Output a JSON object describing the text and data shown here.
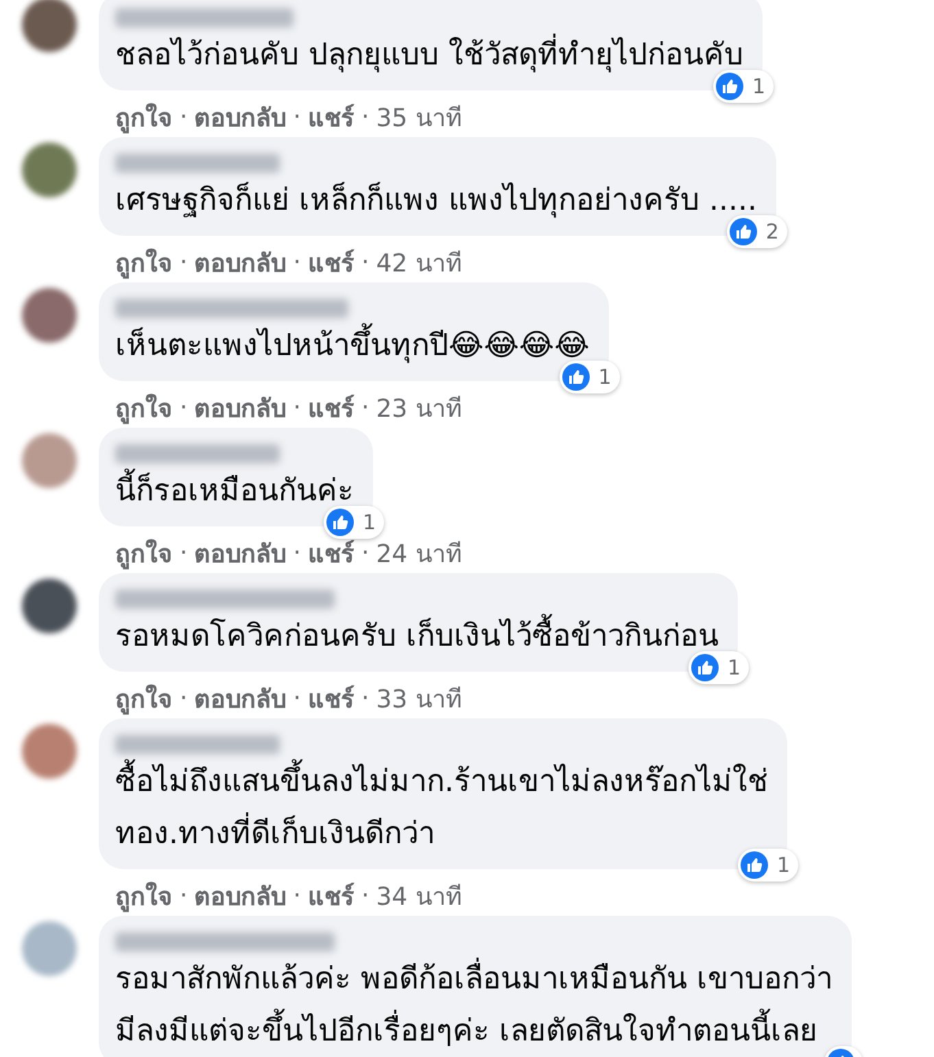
{
  "comments": [
    {
      "text": "ชลอไว้ก่อนคับ ปลุกยุแบบ ใช้วัสดุที่ทำยุไปก่อนคับ",
      "reaction_count": "1",
      "actions": [
        {
          "kind": "link",
          "text": "ถูกใจ"
        },
        {
          "kind": "dot",
          "text": "·"
        },
        {
          "kind": "link",
          "text": "ตอบกลับ"
        },
        {
          "kind": "dot",
          "text": "·"
        },
        {
          "kind": "link",
          "text": "แชร์"
        },
        {
          "kind": "dot",
          "text": "·"
        },
        {
          "kind": "time",
          "text": "35 นาที"
        }
      ]
    },
    {
      "text": "เศรษฐกิจก็แย่ เหล็กก็แพง แพงไปทุกอย่างครับ .....",
      "reaction_count": "2",
      "actions": [
        {
          "kind": "link",
          "text": "ถูกใจ"
        },
        {
          "kind": "dot",
          "text": "·"
        },
        {
          "kind": "link",
          "text": "ตอบกลับ"
        },
        {
          "kind": "dot",
          "text": "·"
        },
        {
          "kind": "link",
          "text": "แชร์"
        },
        {
          "kind": "dot",
          "text": "·"
        },
        {
          "kind": "time",
          "text": "42 นาที"
        }
      ]
    },
    {
      "text": "เห็นตะแพงไปหน้าขึ้นทุกปี😂😂😂😂",
      "reaction_count": "1",
      "actions": [
        {
          "kind": "link",
          "text": "ถูกใจ"
        },
        {
          "kind": "dot",
          "text": "·"
        },
        {
          "kind": "link",
          "text": "ตอบกลับ"
        },
        {
          "kind": "dot",
          "text": "·"
        },
        {
          "kind": "link",
          "text": "แชร์"
        },
        {
          "kind": "dot",
          "text": "·"
        },
        {
          "kind": "time",
          "text": "23 นาที"
        }
      ]
    },
    {
      "text": "นี้ก็รอเหมือนกันค่ะ",
      "reaction_count": "1",
      "actions": [
        {
          "kind": "link",
          "text": "ถูกใจ"
        },
        {
          "kind": "dot",
          "text": "·"
        },
        {
          "kind": "link",
          "text": "ตอบกลับ"
        },
        {
          "kind": "dot",
          "text": "·"
        },
        {
          "kind": "link",
          "text": "แชร์"
        },
        {
          "kind": "dot",
          "text": "·"
        },
        {
          "kind": "time",
          "text": "24 นาที"
        }
      ]
    },
    {
      "text": "รอหมดโควิคก่อนครับ เก็บเงินไว้ซื้อข้าวกินก่อน",
      "reaction_count": "1",
      "actions": [
        {
          "kind": "link",
          "text": "ถูกใจ"
        },
        {
          "kind": "dot",
          "text": "·"
        },
        {
          "kind": "link",
          "text": "ตอบกลับ"
        },
        {
          "kind": "dot",
          "text": "·"
        },
        {
          "kind": "link",
          "text": "แชร์"
        },
        {
          "kind": "dot",
          "text": "·"
        },
        {
          "kind": "time",
          "text": "33 นาที"
        }
      ]
    },
    {
      "text": "ซื้อไม่ถึงแสนขึ้นลงไม่มาก.ร้านเขาไม่ลงหร๊อกไม่ใช่\nทอง.ทางที่ดีเก็บเงินดีกว่า",
      "reaction_count": "1",
      "actions": [
        {
          "kind": "link",
          "text": "ถูกใจ"
        },
        {
          "kind": "dot",
          "text": "·"
        },
        {
          "kind": "link",
          "text": "ตอบกลับ"
        },
        {
          "kind": "dot",
          "text": "·"
        },
        {
          "kind": "link",
          "text": "แชร์"
        },
        {
          "kind": "dot",
          "text": "·"
        },
        {
          "kind": "time",
          "text": "34 นาที"
        }
      ]
    },
    {
      "text": "รอมาสักพักแล้วค่ะ พอดีก้อเลื่อนมาเหมือนกัน เขาบอกว่า\nมีลงมีแต่จะขึ้นไปอีกเรื่อยๆค่ะ เลยตัดสินใจทำตอนนี้เลย",
      "reaction_icon": true
    }
  ]
}
